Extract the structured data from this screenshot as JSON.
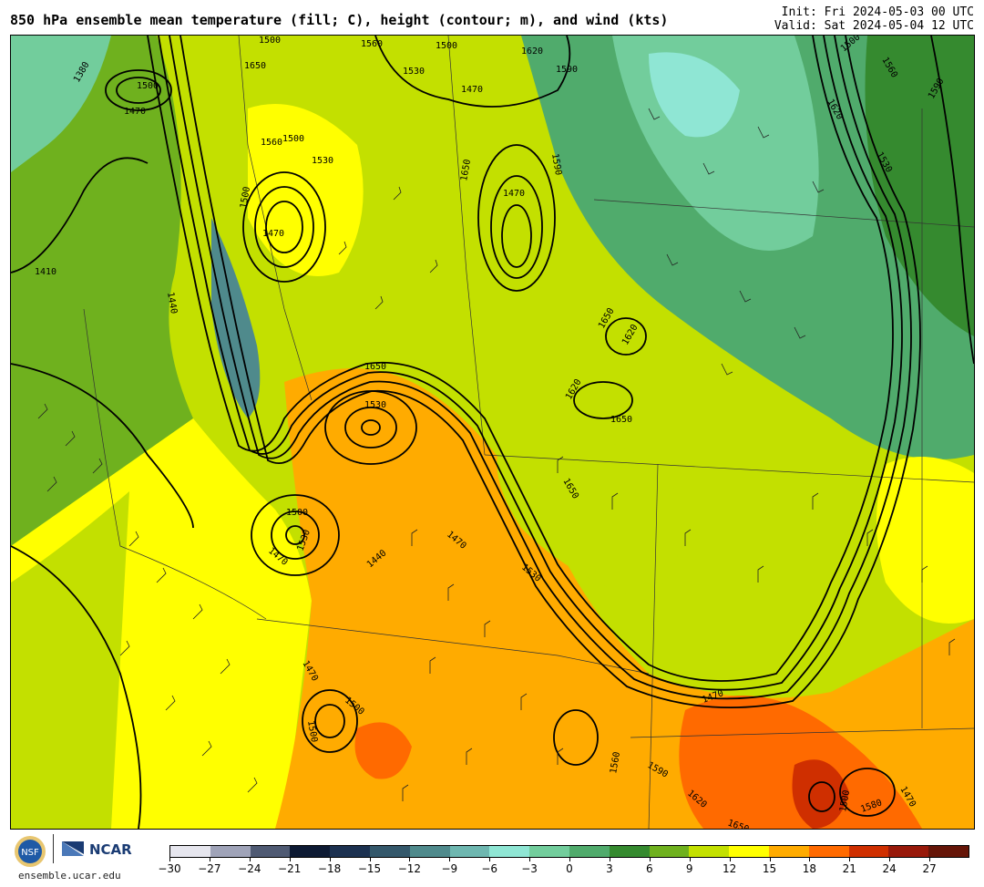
{
  "header": {
    "title": "850 hPa ensemble mean temperature (fill; C), height (contour; m), and wind (kts)",
    "init": "Init: Fri 2024-05-03 00 UTC",
    "valid": "Valid: Sat 2024-05-04 12 UTC"
  },
  "footer": {
    "site": "ensemble.ucar.edu",
    "ncar": "NCAR",
    "nsf": "NSF"
  },
  "colorbar": {
    "colors": [
      "#e6e6ee",
      "#9fa3b8",
      "#4f5a73",
      "#0d1a33",
      "#1c3150",
      "#34586b",
      "#4f8a8c",
      "#6eb7b0",
      "#8fe6d4",
      "#72cd9c",
      "#50ab6c",
      "#358a2f",
      "#6fb11e",
      "#c3e000",
      "#ffff00",
      "#ffab00",
      "#ff6a00",
      "#cf2f00",
      "#98190a",
      "#651508"
    ],
    "labels": [
      "−30",
      "−27",
      "−24",
      "−21",
      "−18",
      "−15",
      "−12",
      "−9",
      "−6",
      "−3",
      "0",
      "3",
      "6",
      "9",
      "12",
      "15",
      "18",
      "21",
      "24",
      "27"
    ]
  },
  "map": {
    "contour_labels": [
      "1380",
      "1500",
      "1470",
      "1500",
      "1650",
      "1560",
      "1530",
      "1500",
      "1470",
      "1620",
      "1590",
      "1470",
      "1560",
      "1650",
      "1500",
      "1530",
      "1470",
      "1500",
      "1590",
      "1410",
      "1440",
      "1530",
      "1650",
      "1620",
      "1650",
      "1620",
      "1650",
      "1650",
      "1530",
      "1500",
      "1470",
      "1440",
      "1470",
      "1470",
      "1500",
      "1530",
      "1560",
      "1590",
      "1620",
      "1650",
      "1470",
      "1500",
      "1580",
      "1470",
      "1500",
      "1530",
      "1620",
      "1500",
      "1560",
      "1590"
    ]
  }
}
